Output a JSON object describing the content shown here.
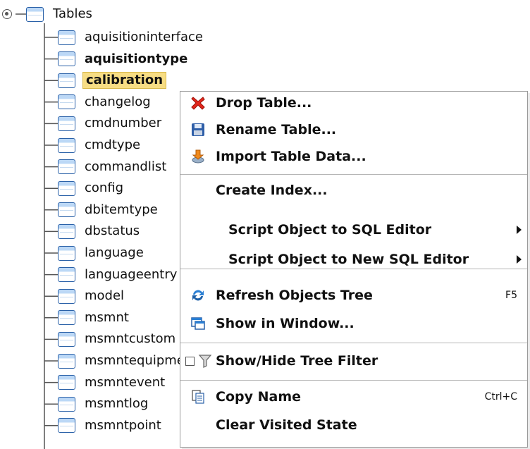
{
  "tree": {
    "root_label": "Tables",
    "items": [
      {
        "label": "aquisitioninterface",
        "style": "normal"
      },
      {
        "label": "aquisitiontype",
        "style": "bold"
      },
      {
        "label": "calibration",
        "style": "selected"
      },
      {
        "label": "changelog",
        "style": "normal"
      },
      {
        "label": "cmdnumber",
        "style": "normal"
      },
      {
        "label": "cmdtype",
        "style": "normal"
      },
      {
        "label": "commandlist",
        "style": "normal"
      },
      {
        "label": "config",
        "style": "normal"
      },
      {
        "label": "dbitemtype",
        "style": "normal"
      },
      {
        "label": "dbstatus",
        "style": "normal"
      },
      {
        "label": "language",
        "style": "normal"
      },
      {
        "label": "languageentry",
        "style": "normal"
      },
      {
        "label": "model",
        "style": "normal"
      },
      {
        "label": "msmnt",
        "style": "normal"
      },
      {
        "label": "msmntcustom",
        "style": "normal"
      },
      {
        "label": "msmntequipment",
        "style": "normal"
      },
      {
        "label": "msmntevent",
        "style": "normal"
      },
      {
        "label": "msmntlog",
        "style": "normal"
      },
      {
        "label": "msmntpoint",
        "style": "normal"
      }
    ]
  },
  "menu": {
    "drop_table": "Drop Table...",
    "rename_table": "Rename Table...",
    "import_table_data": "Import Table Data...",
    "create_index": "Create Index...",
    "script_to_sql_editor": "Script Object to SQL Editor",
    "script_to_new_sql_editor": "Script Object to New SQL Editor",
    "refresh_objects_tree": "Refresh Objects Tree",
    "refresh_shortcut": "F5",
    "show_in_window": "Show in Window...",
    "show_hide_tree_filter": "Show/Hide Tree Filter",
    "copy_name": "Copy Name",
    "copy_shortcut": "Ctrl+C",
    "clear_visited_state": "Clear Visited State"
  },
  "icons": {
    "root_expander": "expanded-node-icon",
    "table": "table-icon",
    "drop": "red-x-icon",
    "rename": "floppy-disk-icon",
    "import": "import-arrow-icon",
    "refresh": "refresh-arrows-icon",
    "show_window": "window-icon",
    "filter": "funnel-icon",
    "copy": "copy-document-icon"
  },
  "colors": {
    "selection_bg": "#f7dd84",
    "table_icon_blue": "#2a61a8",
    "menu_border": "#9a9a9a"
  }
}
